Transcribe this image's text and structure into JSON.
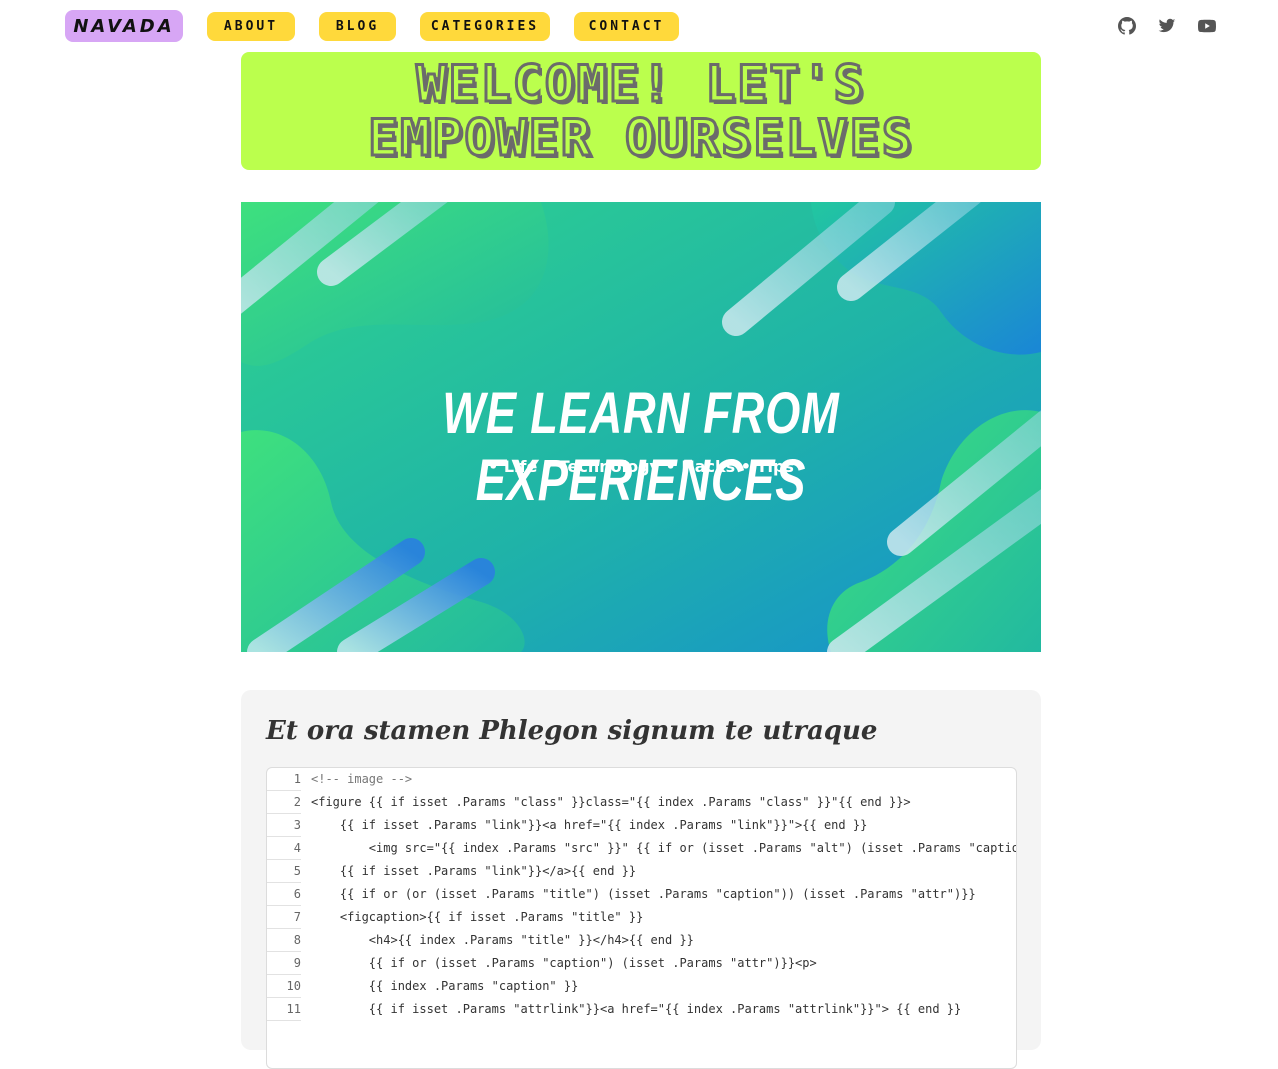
{
  "nav": {
    "brand": "NAVADA",
    "items": [
      "ABOUT",
      "BLOG",
      "CATEGORIES",
      "CONTACT"
    ],
    "social": [
      {
        "name": "github-icon"
      },
      {
        "name": "twitter-icon"
      },
      {
        "name": "youtube-icon"
      }
    ]
  },
  "welcome": {
    "line1": "WELCOME! LET'S",
    "line2": "EMPOWER OURSELVES"
  },
  "hero": {
    "title": "WE LEARN FROM EXPERIENCES",
    "subtitle": "• Life • Technology • Hacks • Tips"
  },
  "post": {
    "title": "Et ora stamen Phlegon signum te utraque"
  },
  "code": {
    "lines": [
      "<!-- image -->",
      "<figure {{ if isset .Params \"class\" }}class=\"{{ index .Params \"class\" }}\"{{ end }}>",
      "    {{ if isset .Params \"link\"}}<a href=\"{{ index .Params \"link\"}}\">{{ end }}",
      "        <img src=\"{{ index .Params \"src\" }}\" {{ if or (isset .Params \"alt\") (isset .Params \"captio",
      "    {{ if isset .Params \"link\"}}</a>{{ end }}",
      "    {{ if or (or (isset .Params \"title\") (isset .Params \"caption\")) (isset .Params \"attr\")}}",
      "    <figcaption>{{ if isset .Params \"title\" }}",
      "        <h4>{{ index .Params \"title\" }}</h4>{{ end }}",
      "        {{ if or (isset .Params \"caption\") (isset .Params \"attr\")}}<p>",
      "        {{ index .Params \"caption\" }}",
      "        {{ if isset .Params \"attrlink\"}}<a href=\"{{ index .Params \"attrlink\"}}\"> {{ end }}"
    ]
  }
}
